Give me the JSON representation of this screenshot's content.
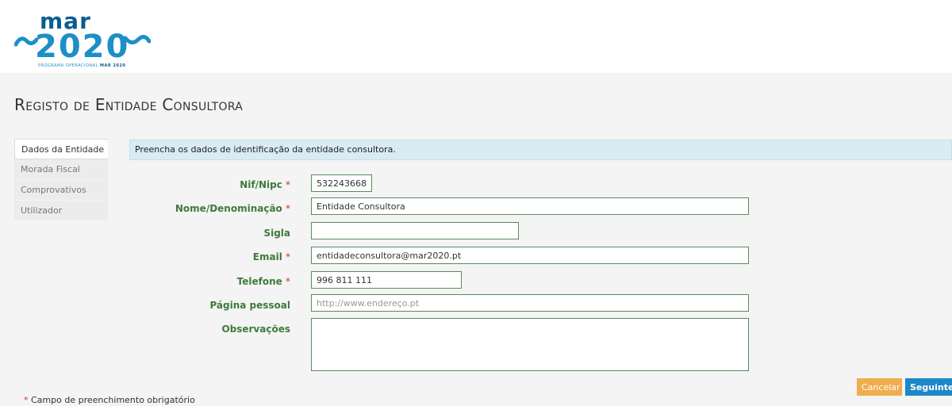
{
  "logo": {
    "word": "mar",
    "year": "2020",
    "subtitle_prefix": "PROGRAMA OPERACIONAL",
    "subtitle_brand": "MAR 2020"
  },
  "page": {
    "title": "Registo de Entidade Consultora",
    "info": "Preencha os dados de identificação da entidade consultora."
  },
  "tabs": [
    {
      "label": "Dados da Entidade",
      "active": true
    },
    {
      "label": "Morada Fiscal",
      "active": false
    },
    {
      "label": "Comprovativos",
      "active": false
    },
    {
      "label": "Utilizador",
      "active": false
    }
  ],
  "form": {
    "nif": {
      "label": "Nif/Nipc",
      "required": "*",
      "value": "532243668"
    },
    "nome": {
      "label": "Nome/Denominação",
      "required": "*",
      "value": "Entidade Consultora"
    },
    "sigla": {
      "label": "Sigla",
      "value": ""
    },
    "email": {
      "label": "Email",
      "required": "*",
      "value": "entidadeconsultora@mar2020.pt"
    },
    "telefone": {
      "label": "Telefone",
      "required": "*",
      "value": "996 811 111"
    },
    "pagina": {
      "label": "Página pessoal",
      "value": "",
      "placeholder": "http://www.endereço.pt"
    },
    "observacoes": {
      "label": "Observações",
      "value": ""
    }
  },
  "buttons": {
    "cancel": "Cancelar",
    "next": "Seguinte"
  },
  "footnote": {
    "marker": "*",
    "text": "Campo de preenchimento obrigatório"
  },
  "colors": {
    "brand_dark": "#0a5e8f",
    "brand_light": "#1c8fc7",
    "label_green": "#3e7a3c",
    "required_red": "#c0392b",
    "cancel_orange": "#f0ad4e",
    "next_blue": "#1e88c7",
    "info_bg": "#d9ebf3"
  }
}
